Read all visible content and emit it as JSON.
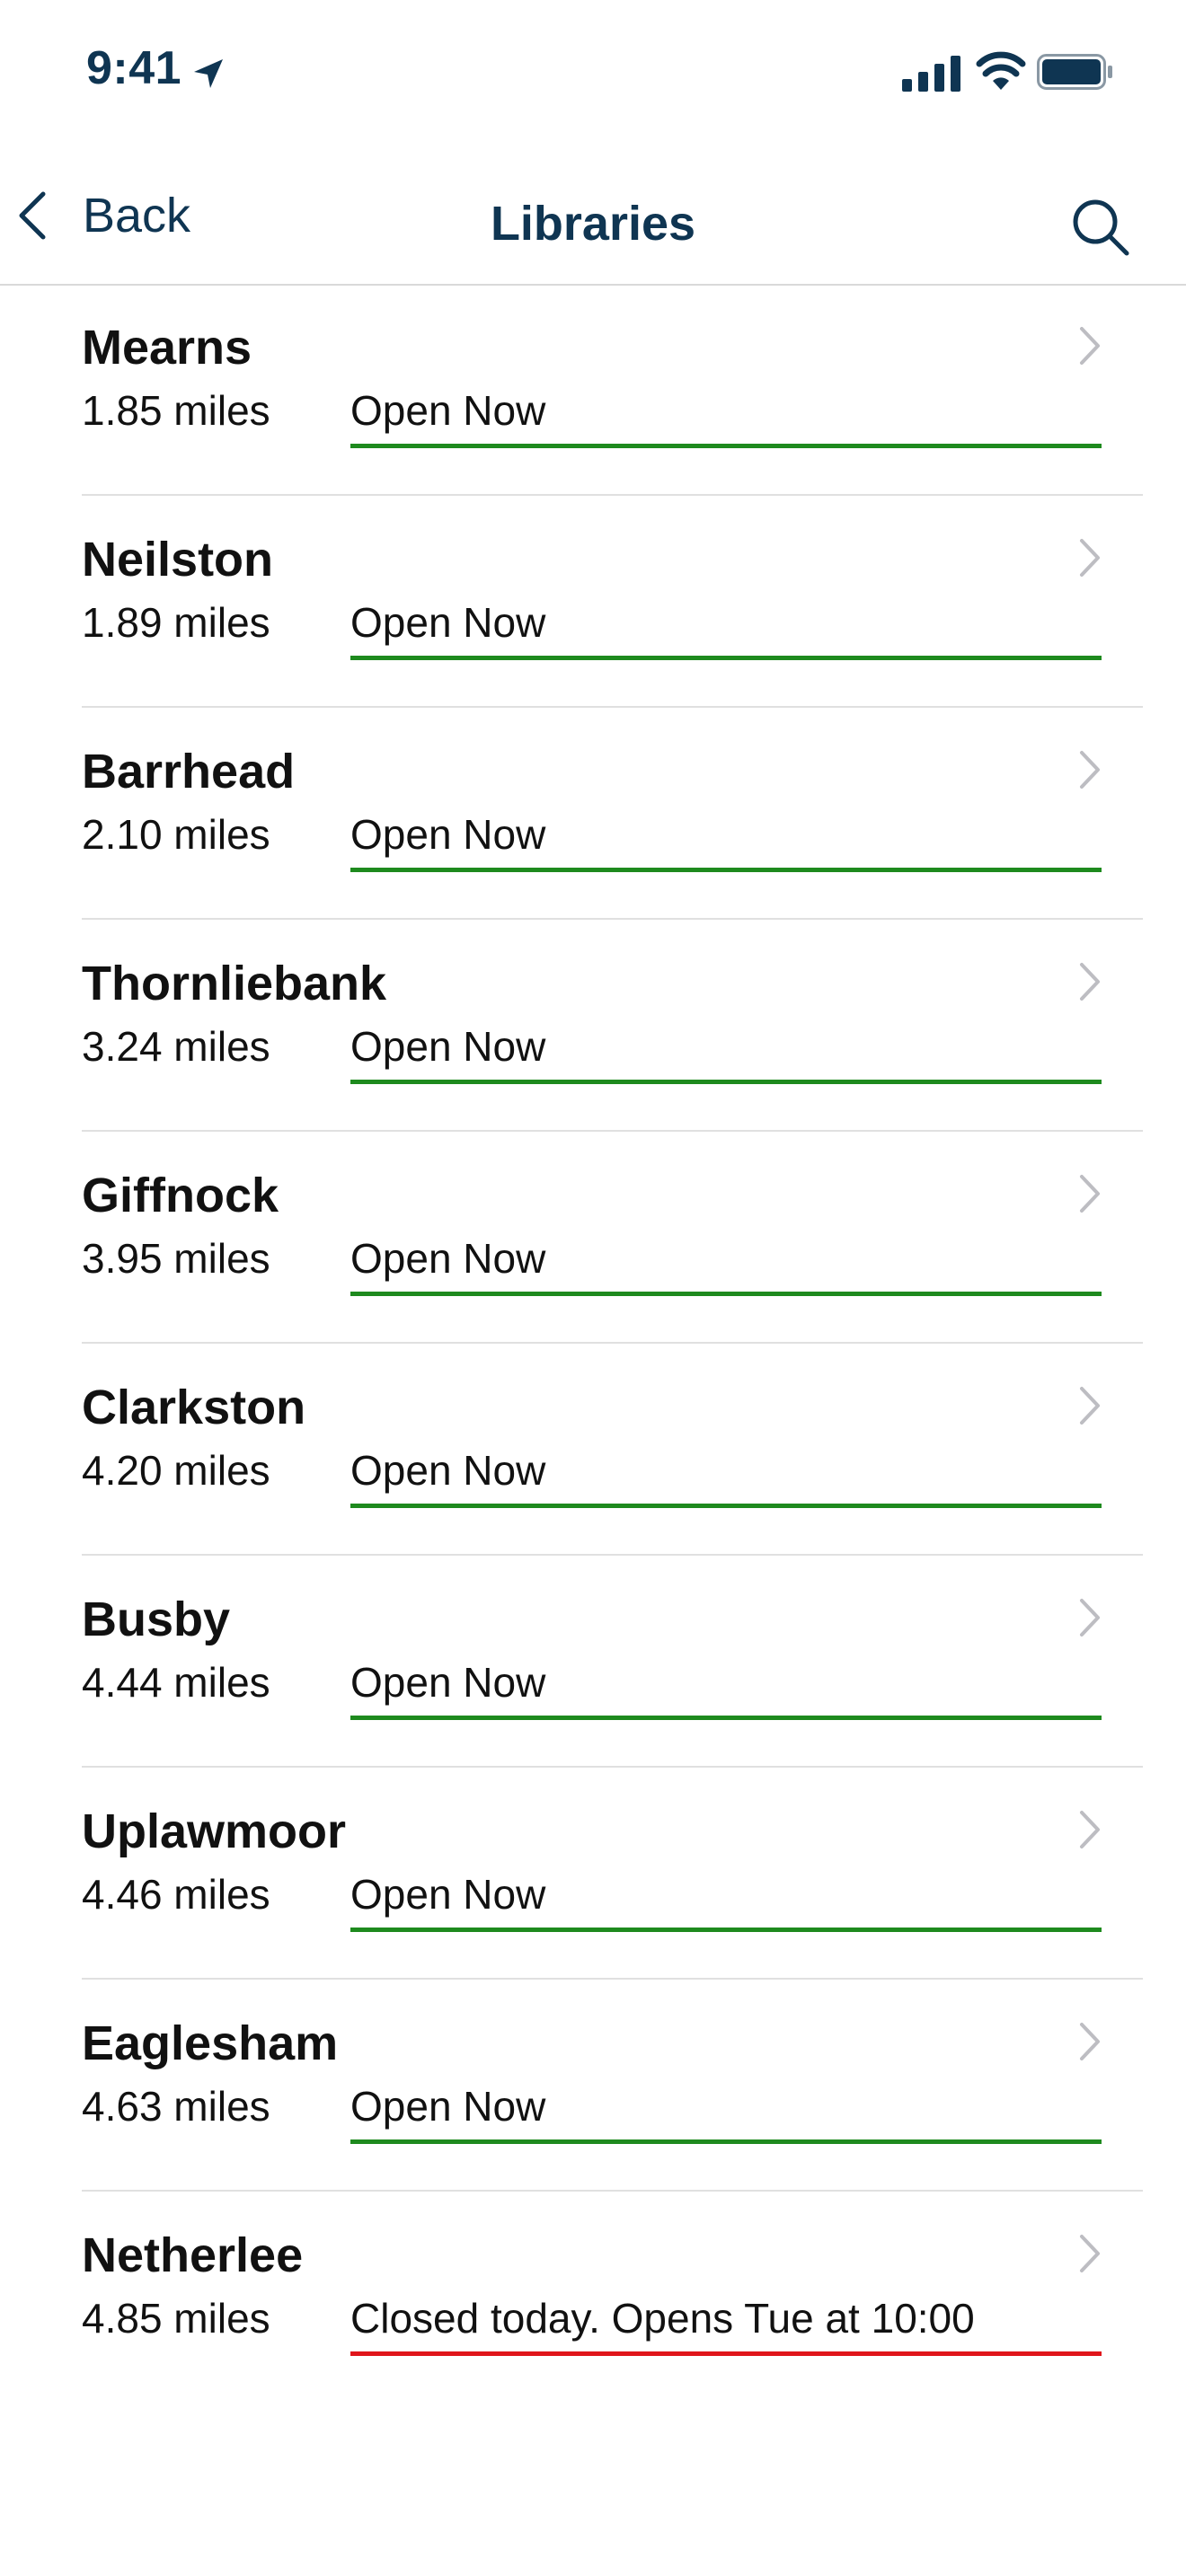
{
  "status_bar": {
    "time": "9:41",
    "icons": [
      "location-arrow-icon",
      "cellular-signal-icon",
      "wifi-icon",
      "battery-icon"
    ]
  },
  "nav": {
    "back_label": "Back",
    "title": "Libraries",
    "search_icon": "search-icon"
  },
  "colors": {
    "accent": "#0f3552",
    "open": "#1e8a1e",
    "closed": "#e0151b"
  },
  "libraries": [
    {
      "name": "Mearns",
      "distance": "1.85 miles",
      "status": "Open Now",
      "open": true
    },
    {
      "name": "Neilston",
      "distance": "1.89 miles",
      "status": "Open Now",
      "open": true
    },
    {
      "name": "Barrhead",
      "distance": "2.10 miles",
      "status": "Open Now",
      "open": true
    },
    {
      "name": "Thornliebank",
      "distance": "3.24 miles",
      "status": "Open Now",
      "open": true
    },
    {
      "name": "Giffnock",
      "distance": "3.95 miles",
      "status": "Open Now",
      "open": true
    },
    {
      "name": "Clarkston",
      "distance": "4.20 miles",
      "status": "Open Now",
      "open": true
    },
    {
      "name": "Busby",
      "distance": "4.44 miles",
      "status": "Open Now",
      "open": true
    },
    {
      "name": "Uplawmoor",
      "distance": "4.46 miles",
      "status": "Open Now",
      "open": true
    },
    {
      "name": "Eaglesham",
      "distance": "4.63 miles",
      "status": "Open Now",
      "open": true
    },
    {
      "name": "Netherlee",
      "distance": "4.85 miles",
      "status": "Closed today. Opens Tue at 10:00",
      "open": false
    }
  ]
}
